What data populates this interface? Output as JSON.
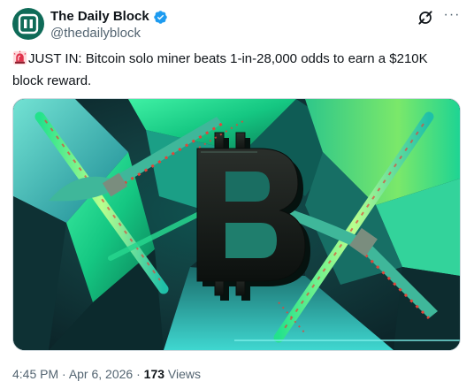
{
  "author": {
    "display_name": "The Daily Block",
    "handle": "@thedailyblock",
    "verified": true,
    "avatar_icon": "daily-block-logo",
    "avatar_color": "#0f6b58"
  },
  "actions": {
    "grok_icon": "grok-icon",
    "more_icon": "more-icon",
    "more_label": "···"
  },
  "tweet": {
    "emoji": "rotating-light",
    "text_line": "JUST IN: Bitcoin solo miner beats 1-in-28,000 odds to earn a $210K block reward."
  },
  "media": {
    "description_icon": "bitcoin-pickaxe-image",
    "colors": {
      "accent_green": "#1ee88f",
      "accent_cyan": "#2fd6e0",
      "dark": "#0d1f24",
      "red_streak": "#e2453a"
    }
  },
  "meta": {
    "time": "4:45 PM",
    "separator": " · ",
    "date": "Apr 6, 2026",
    "views_count": "173",
    "views_label": "Views"
  }
}
